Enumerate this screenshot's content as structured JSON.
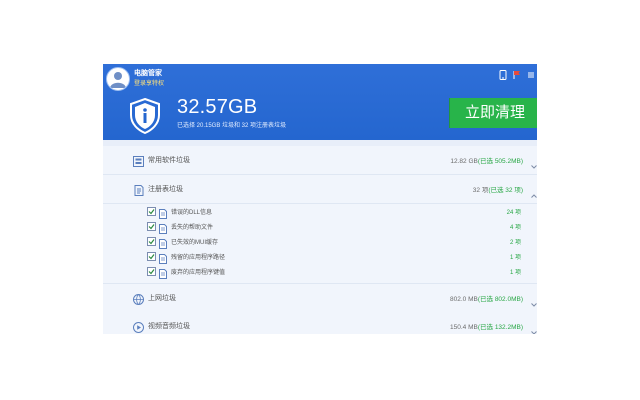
{
  "header": {
    "app_title": "电脑管家",
    "app_subtitle": "登录享特权",
    "size": "32.57GB",
    "size_desc": "已选择 20.15GB 垃圾和 32 项注册表垃圾",
    "clean_button": "立即清理"
  },
  "list": {
    "top_strip_label": "",
    "categories": [
      {
        "name": "常用软件垃圾",
        "size": "12.82 GB",
        "selected": "(已选 505.2MB)",
        "expanded": false,
        "icon": "software-icon"
      },
      {
        "name": "注册表垃圾",
        "size": "32 项",
        "selected": "(已选 32 项)",
        "expanded": true,
        "icon": "registry-icon"
      },
      {
        "name": "上网垃圾",
        "size": "802.0 MB",
        "selected": "(已选 802.0MB)",
        "expanded": false,
        "icon": "globe-icon"
      },
      {
        "name": "视频音频垃圾",
        "size": "150.4 MB",
        "selected": "(已选 132.2MB)",
        "expanded": false,
        "icon": "play-icon"
      }
    ],
    "registry_items": [
      {
        "name": "错误的DLL信息",
        "count": "24 项"
      },
      {
        "name": "丢失的帮助文件",
        "count": "4 项"
      },
      {
        "name": "已失效的MUI缓存",
        "count": "2 项"
      },
      {
        "name": "残留的应用程序路径",
        "count": "1 项"
      },
      {
        "name": "废弃的应用程序键值",
        "count": "1 项"
      }
    ]
  },
  "colors": {
    "header_blue": "#2466cf",
    "clean_green": "#28b44a",
    "selected_green": "#28a745"
  }
}
